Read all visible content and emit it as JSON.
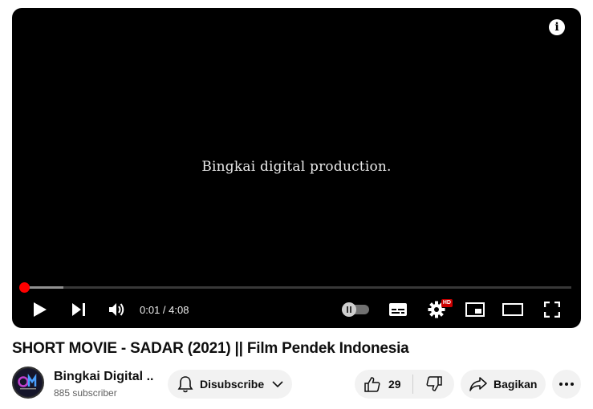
{
  "player": {
    "frame_text": "Bingkai digital production.",
    "progress": {
      "played_fraction": 0.004,
      "buffered_fraction": 0.076
    },
    "time_current": "0:01",
    "time_separator": " / ",
    "time_total": "4:08",
    "quality_badge": "HD",
    "icons": {
      "info": "info-icon",
      "play": "play-icon",
      "next": "next-icon",
      "volume": "volume-icon",
      "autoplay": "autoplay-toggle-icon",
      "subtitles": "subtitles-icon",
      "settings": "gear-icon",
      "miniplayer": "miniplayer-icon",
      "theater": "theater-mode-icon",
      "fullscreen": "fullscreen-icon"
    }
  },
  "video": {
    "title": "SHORT MOVIE - SADAR (2021) || Film Pendek Indonesia"
  },
  "channel": {
    "name": "Bingkai Digital ...",
    "subscribers": "885 subscriber",
    "avatar_text": "DM"
  },
  "actions": {
    "subscribe_label": "Disubscribe",
    "like_count": "29",
    "share_label": "Bagikan"
  },
  "colors": {
    "accent": "#ff0000",
    "button_bg": "#f2f2f2",
    "player_bg": "#000000"
  }
}
